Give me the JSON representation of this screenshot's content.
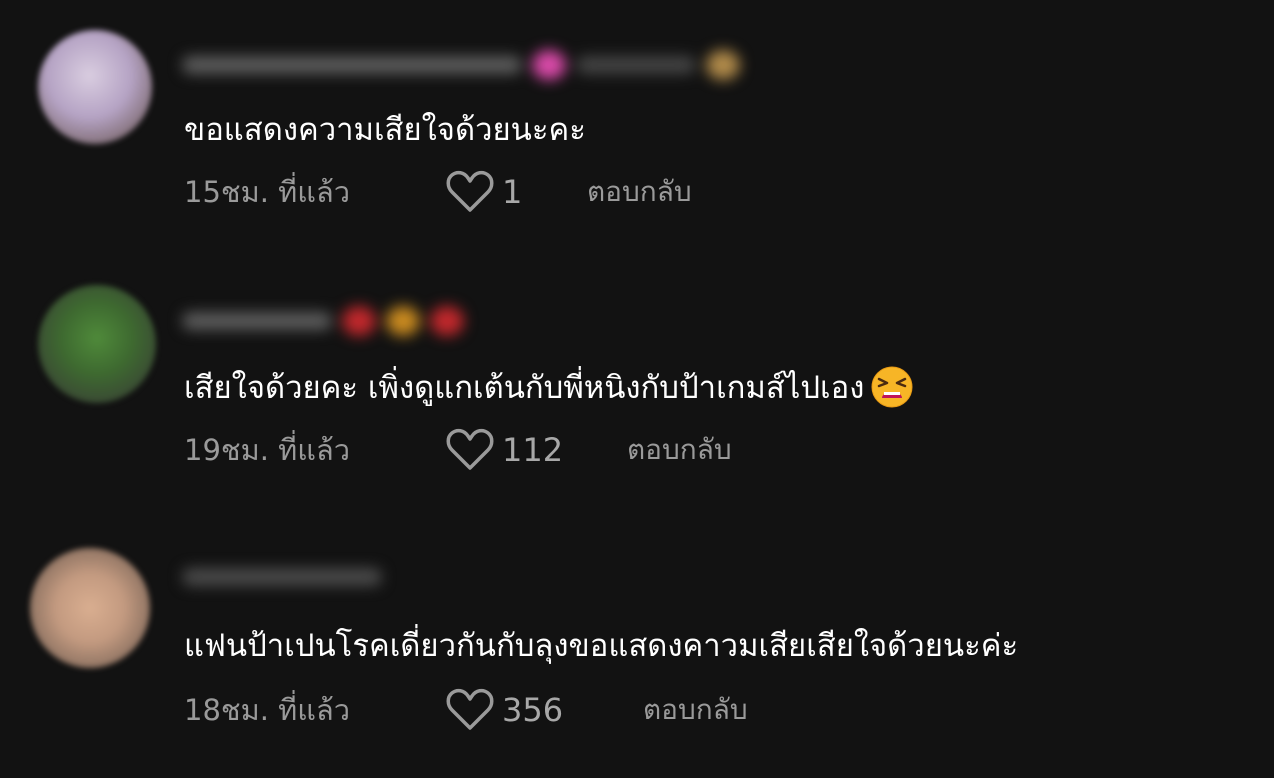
{
  "comments": [
    {
      "text": "ขอแสดงความเสียใจด้วยนะคะ",
      "time": "15ชม. ที่แล้ว",
      "likes": "1",
      "reply_label": "ตอบกลับ",
      "avatar_color": "#b8a8c8"
    },
    {
      "text": "เสียใจด้วยคะ เพิ่งดูแกเต้นกับพี่หนิงกับป้าเกมส์ไปเอง",
      "emoji_icon": "tired-face-emoji",
      "time": "19ชม. ที่แล้ว",
      "likes": "112",
      "reply_label": "ตอบกลับ",
      "avatar_color": "#4a6a3a"
    },
    {
      "text": "แฟนป้าเปนโรคเดี่ยวกันกับลุงขอแสดงคาวมเสียเสียใจด้วยนะค่ะ",
      "time": "18ชม. ที่แล้ว",
      "likes": "356",
      "reply_label": "ตอบกลับ",
      "avatar_color": "#b08a74"
    }
  ],
  "colors": {
    "background": "#121212",
    "text": "#ffffff",
    "meta": "#9a9a9a"
  }
}
